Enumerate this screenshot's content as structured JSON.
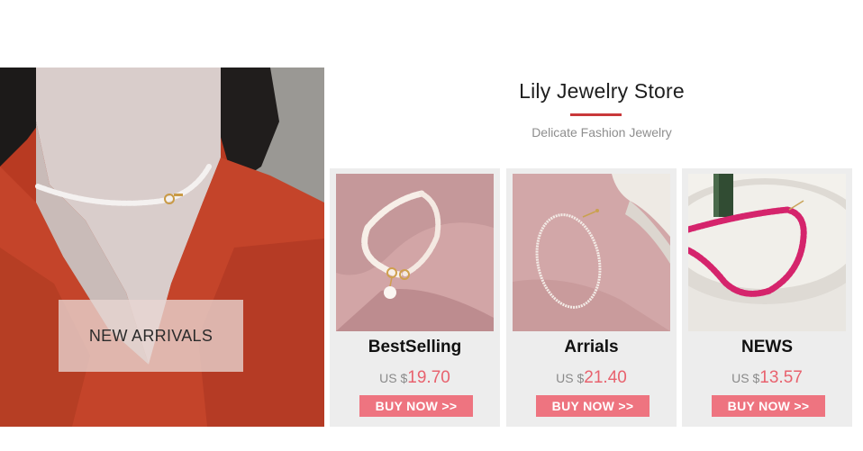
{
  "hero": {
    "label": "NEW ARRIVALS"
  },
  "store": {
    "title": "Lily Jewelry Store",
    "subtitle": "Delicate Fashion Jewelry",
    "accent_color": "#c9383a"
  },
  "products": [
    {
      "name": "BestSelling",
      "currency": "US $",
      "price": "19.70",
      "buy_label": "BUY NOW >>"
    },
    {
      "name": "Arrials",
      "currency": "US $",
      "price": "21.40",
      "buy_label": "BUY NOW >>"
    },
    {
      "name": "NEWS",
      "currency": "US $",
      "price": "13.57",
      "buy_label": "BUY NOW >>"
    }
  ],
  "colors": {
    "price": "#e8626e",
    "button": "#ee7480",
    "card_bg": "#ededed"
  }
}
